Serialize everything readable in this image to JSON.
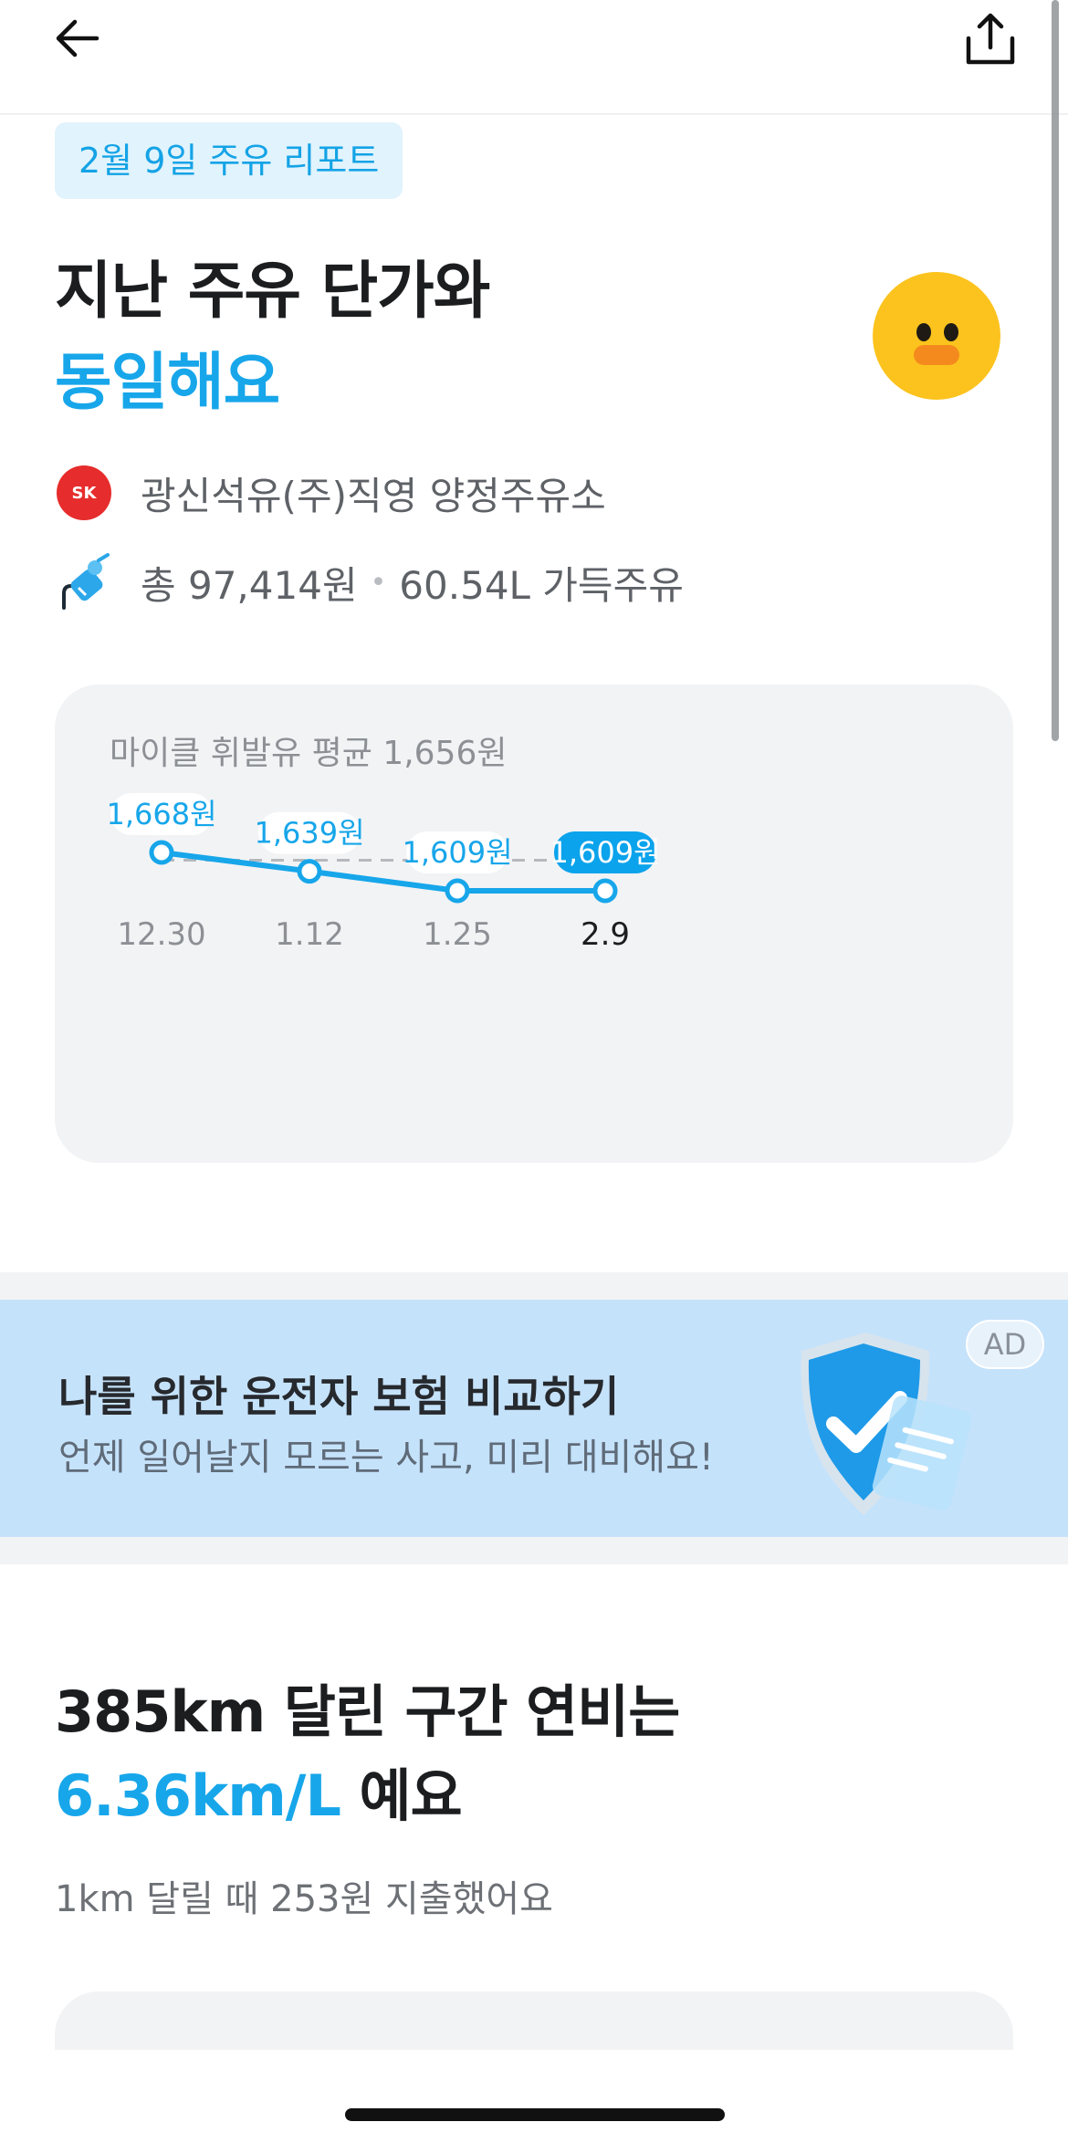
{
  "header": {
    "back_icon": "arrow-left-icon",
    "share_icon": "share-icon"
  },
  "report_tag": "2월 9일 주유 리포트",
  "headline": {
    "line1": "지난 주유 단가와",
    "line2": "동일해요"
  },
  "station": {
    "logo_text": "SK",
    "name": "광신석유(주)직영 양정주유소"
  },
  "fuel": {
    "total": "총 97,414원",
    "separator": "•",
    "amount": "60.54L 가득주유"
  },
  "chart_caption": "마이클 휘발유 평균 1,656원",
  "chart_data": {
    "type": "line",
    "title": "마이클 휘발유 평균 1,656원",
    "categories": [
      "12.30",
      "1.12",
      "1.25",
      "2.9"
    ],
    "labels": [
      "1,668원",
      "1,639원",
      "1,609원",
      "1,609원"
    ],
    "series": [
      {
        "values": [
          1668,
          1639,
          1609,
          1609
        ]
      }
    ],
    "average": 1656,
    "highlight_index": 3,
    "colors": {
      "line": "#17a6ea",
      "average": "#b5b9be",
      "highlight_bg": "#0aa3ec"
    }
  },
  "ad": {
    "title": "나를 위한 운전자 보험 비교하기",
    "subtitle": "언제 일어날지 모르는 사고, 미리 대비해요!",
    "badge": "AD",
    "icon": "shield-check-icon"
  },
  "efficiency": {
    "line1": "385km 달린 구간 연비는",
    "value": "6.36km/L",
    "suffix": " 예요",
    "sub": "1km 달릴 때 253원 지출했어요"
  }
}
